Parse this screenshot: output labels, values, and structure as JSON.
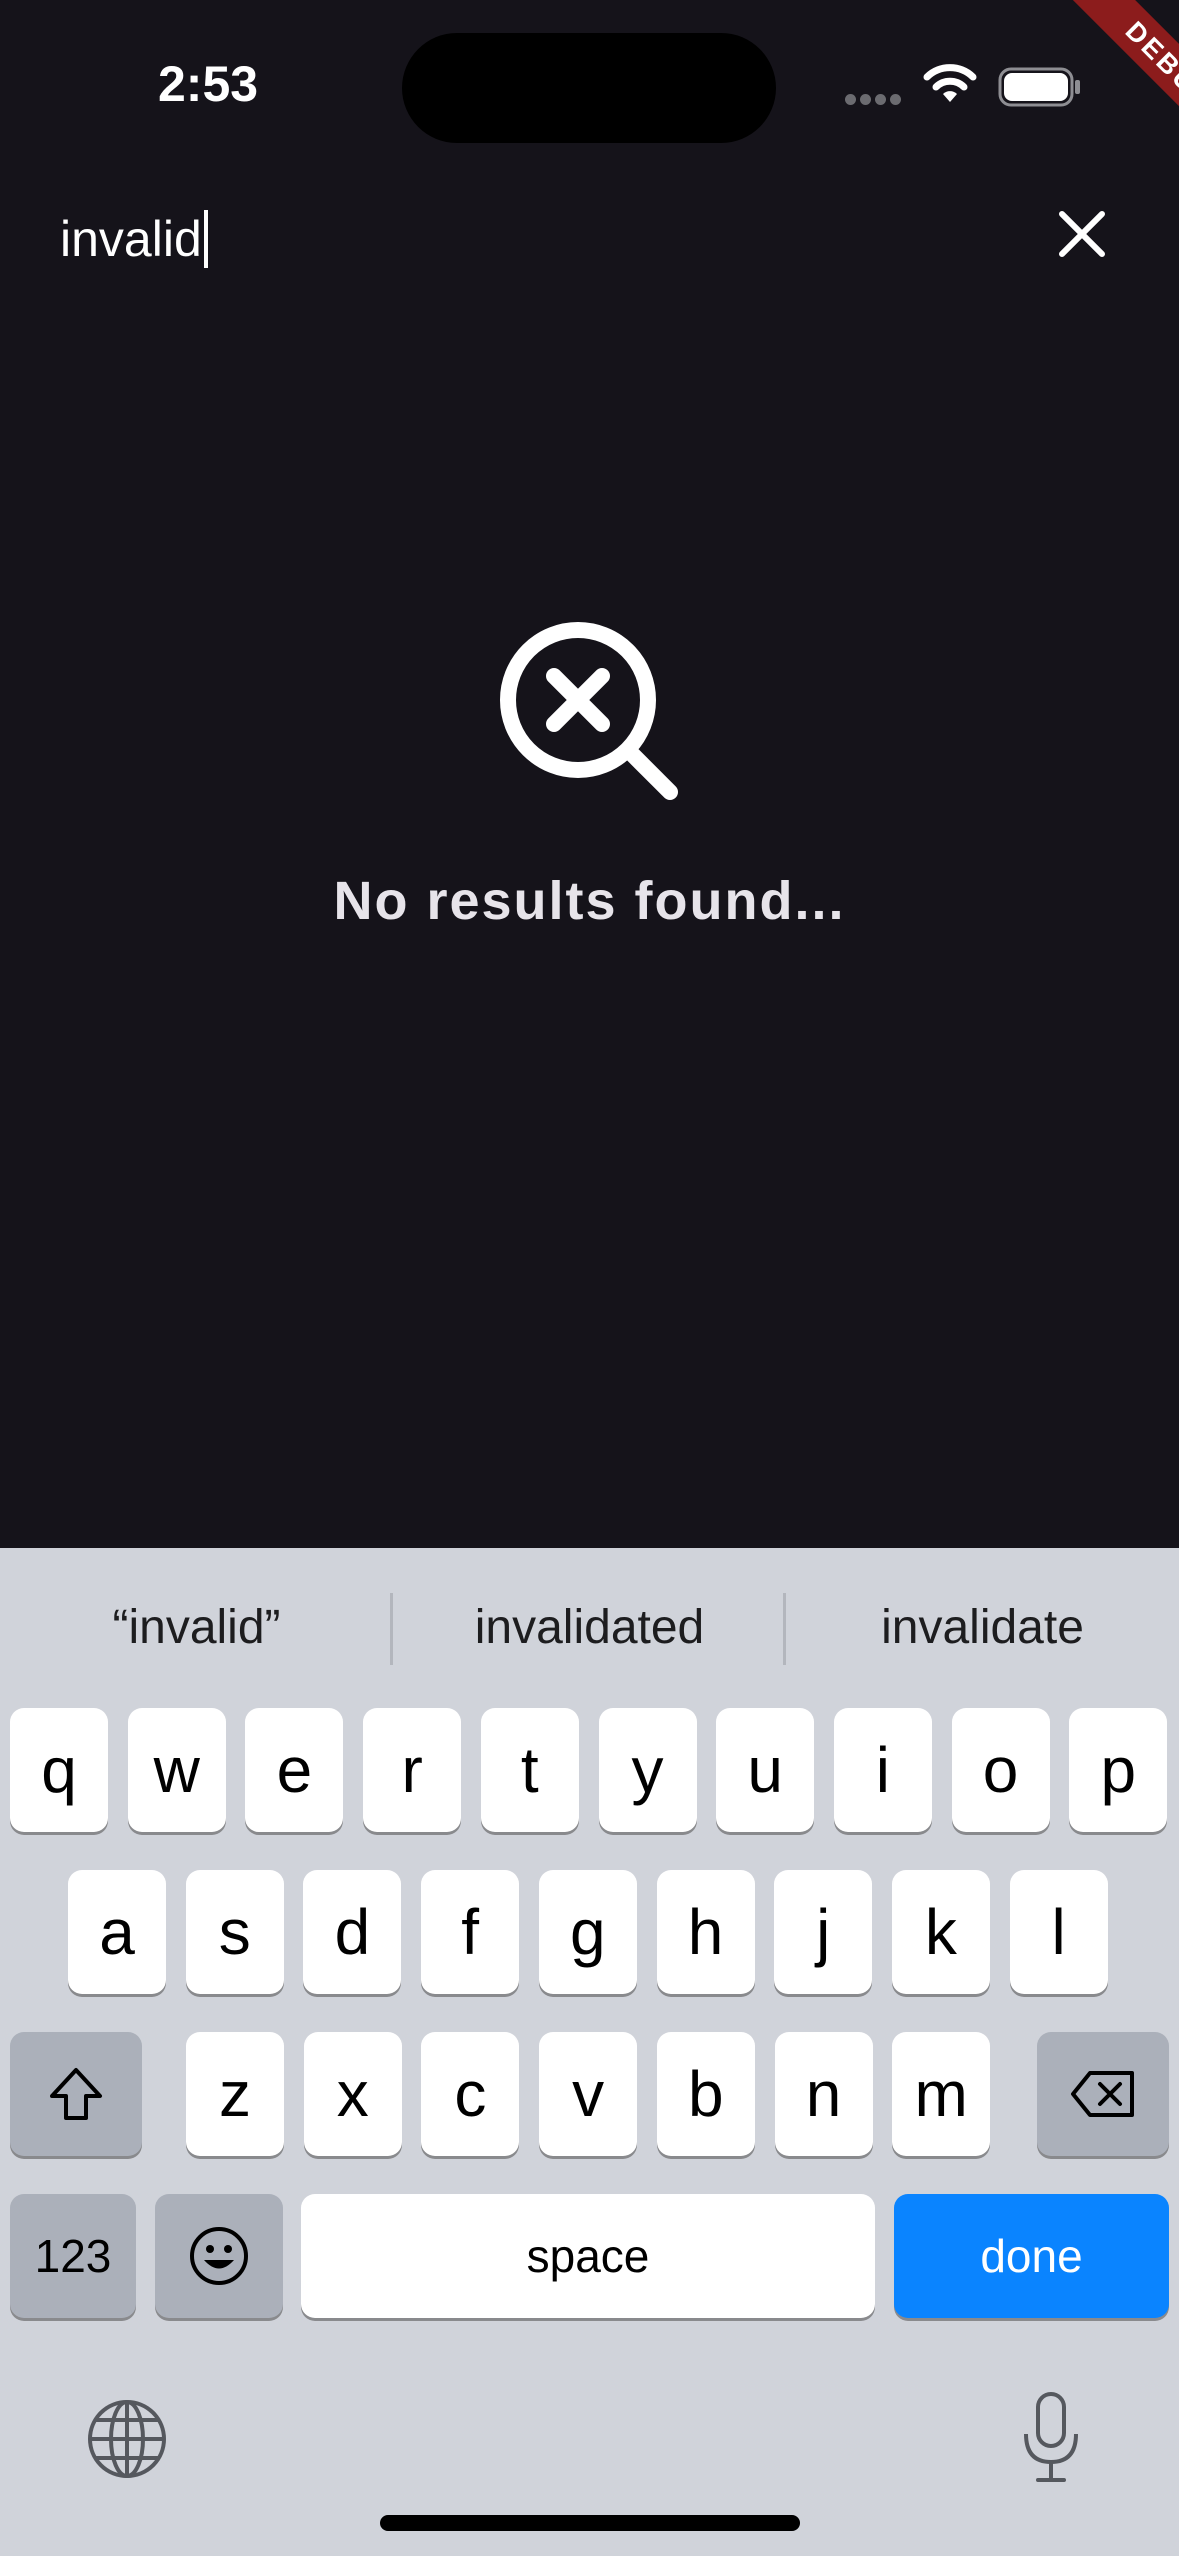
{
  "status_bar": {
    "time": "2:53",
    "debug_label": "DEBUG"
  },
  "search": {
    "query": "invalid"
  },
  "empty_state": {
    "message": "No results found..."
  },
  "keyboard": {
    "suggestions": [
      "“invalid”",
      "invalidated",
      "invalidate"
    ],
    "row1": [
      "q",
      "w",
      "e",
      "r",
      "t",
      "y",
      "u",
      "i",
      "o",
      "p"
    ],
    "row2": [
      "a",
      "s",
      "d",
      "f",
      "g",
      "h",
      "j",
      "k",
      "l"
    ],
    "row3": [
      "z",
      "x",
      "c",
      "v",
      "b",
      "n",
      "m"
    ],
    "numbers_label": "123",
    "space_label": "space",
    "done_label": "done"
  },
  "colors": {
    "accent": "#0a84ff",
    "background": "#15131a",
    "debug_ribbon": "#8c1c1c",
    "keyboard_bg": "#d0d3da"
  }
}
